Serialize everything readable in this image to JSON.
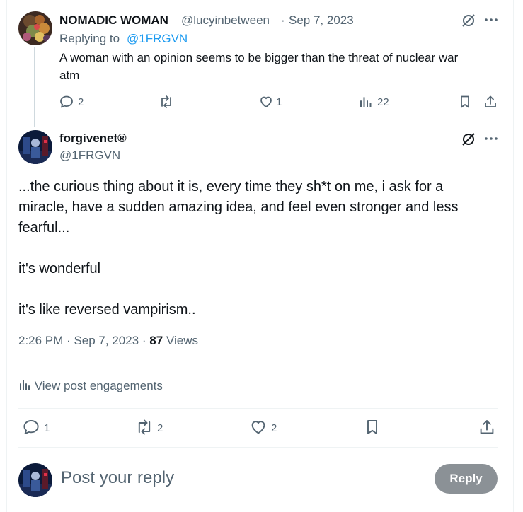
{
  "parent_post": {
    "display_name": "NOMADIC WOMAN",
    "handle": "@lucyinbetween",
    "separator": "·",
    "date": "Sep 7, 2023",
    "replying_prefix": "Replying to",
    "replying_to": "@1FRGVN",
    "text_line1": "A woman with an opinion seems to be bigger than the threat of nuclear war",
    "text_line2": "atm",
    "replies": "2",
    "reposts": "",
    "likes": "1",
    "views": "22"
  },
  "main_post": {
    "display_name": "forgivenet®",
    "handle": "@1FRGVN",
    "body_lines": [
      "...the curious thing about it is, every time they sh*t on me, i ask for a",
      "miracle, have a sudden amazing idea, and feel even stronger and less",
      "fearful...",
      "",
      "it's wonderful",
      "",
      "it's like reversed vampirism.."
    ],
    "time": "2:26 PM",
    "separator": "·",
    "date": "Sep 7, 2023",
    "separator2": "·",
    "views_count": "87",
    "views_label": "Views",
    "engagements_label": "View post engagements",
    "replies": "1",
    "reposts": "2",
    "likes": "2"
  },
  "composer": {
    "placeholder": "Post your reply",
    "reply_button": "Reply"
  },
  "colors": {
    "link": "#1d9bf0",
    "muted": "#536471",
    "reply_button_bg": "#8b9196"
  }
}
